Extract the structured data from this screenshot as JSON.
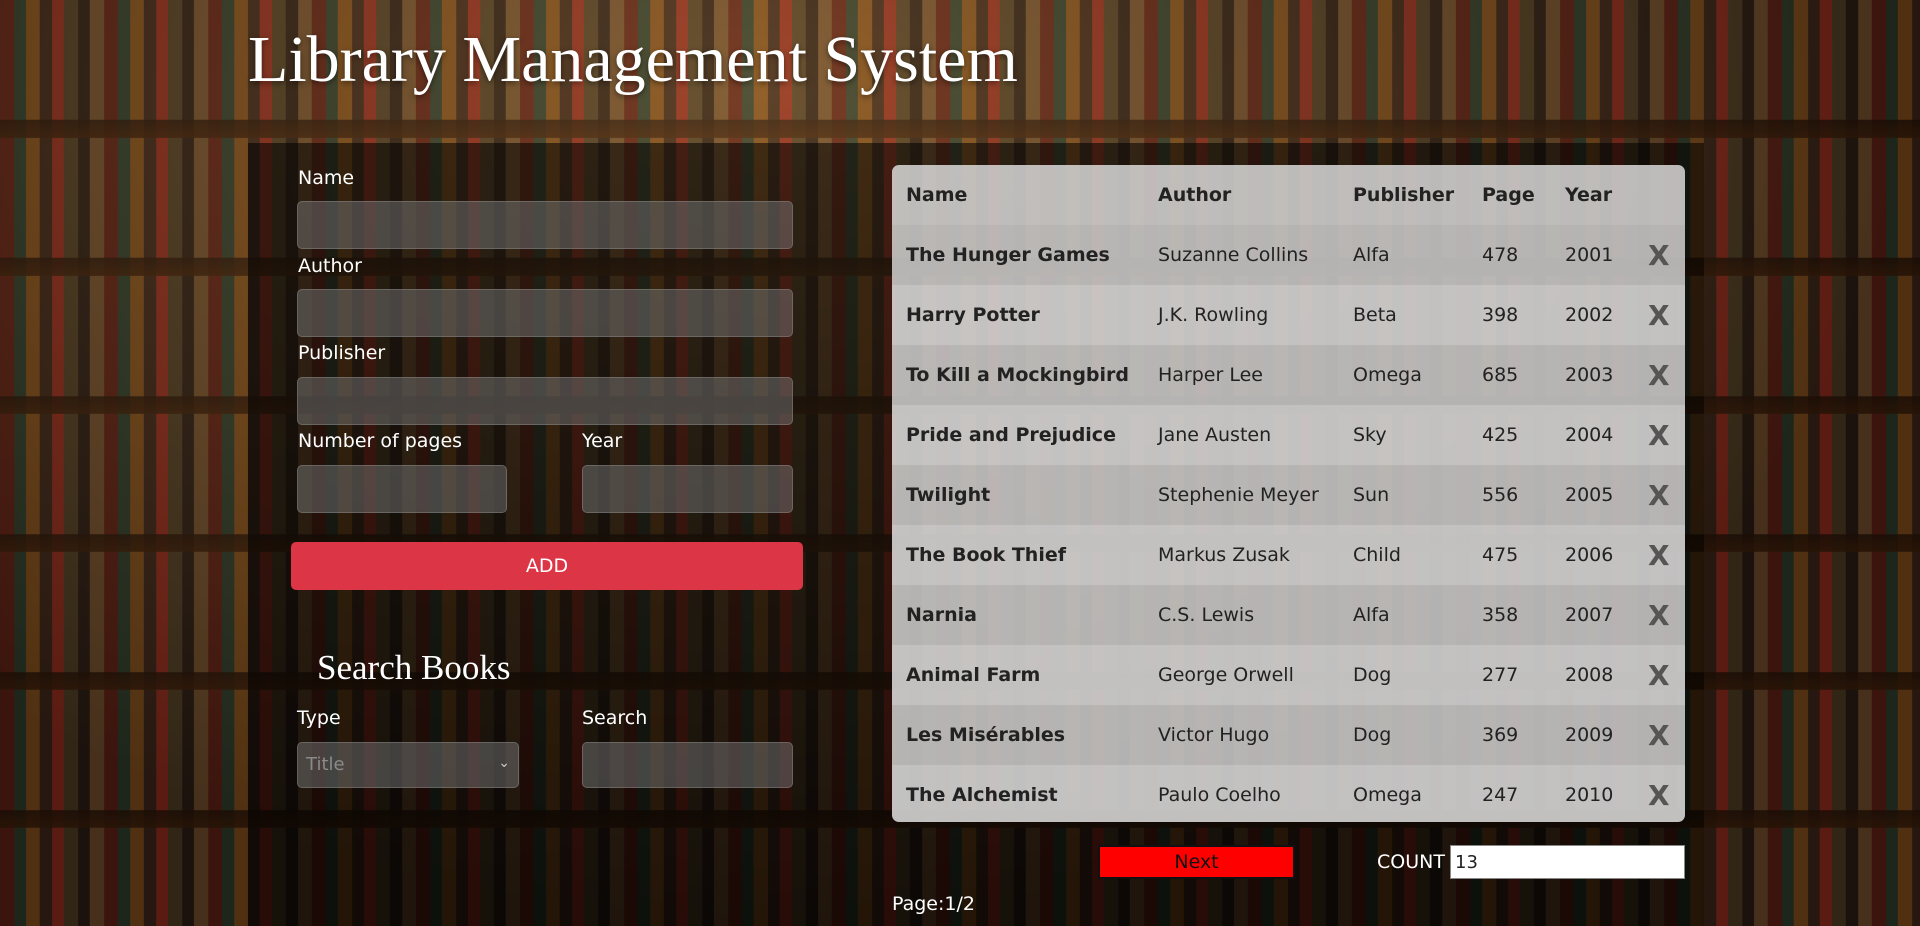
{
  "title": "Library Management System",
  "form": {
    "name_label": "Name",
    "author_label": "Author",
    "publisher_label": "Publisher",
    "pages_label": "Number of pages",
    "year_label": "Year",
    "add_label": "ADD"
  },
  "search": {
    "heading": "Search Books",
    "type_label": "Type",
    "type_selected": "Title",
    "search_label": "Search"
  },
  "table": {
    "headers": {
      "name": "Name",
      "author": "Author",
      "publisher": "Publisher",
      "page": "Page",
      "year": "Year"
    },
    "delete_label": "X",
    "rows": [
      {
        "name": "The Hunger Games",
        "author": "Suzanne Collins",
        "publisher": "Alfa",
        "page": "478",
        "year": "2001"
      },
      {
        "name": "Harry Potter",
        "author": "J.K. Rowling",
        "publisher": "Beta",
        "page": "398",
        "year": "2002"
      },
      {
        "name": "To Kill a Mockingbird",
        "author": "Harper Lee",
        "publisher": "Omega",
        "page": "685",
        "year": "2003"
      },
      {
        "name": "Pride and Prejudice",
        "author": "Jane Austen",
        "publisher": "Sky",
        "page": "425",
        "year": "2004"
      },
      {
        "name": "Twilight",
        "author": "Stephenie Meyer",
        "publisher": "Sun",
        "page": "556",
        "year": "2005"
      },
      {
        "name": "The Book Thief",
        "author": "Markus Zusak",
        "publisher": "Child",
        "page": "475",
        "year": "2006"
      },
      {
        "name": "Narnia",
        "author": "C.S. Lewis",
        "publisher": "Alfa",
        "page": "358",
        "year": "2007"
      },
      {
        "name": "Animal Farm",
        "author": "George Orwell",
        "publisher": "Dog",
        "page": "277",
        "year": "2008"
      },
      {
        "name": "Les Misérables",
        "author": "Victor Hugo",
        "publisher": "Dog",
        "page": "369",
        "year": "2009"
      },
      {
        "name": "The Alchemist",
        "author": "Paulo Coelho",
        "publisher": "Omega",
        "page": "247",
        "year": "2010"
      }
    ]
  },
  "pagination": {
    "next_label": "Next",
    "count_label": "COUNT",
    "count_value": "13",
    "page_info": "Page:1/2"
  },
  "colors": {
    "add_button": "#dc3545",
    "next_button": "#ff0000"
  }
}
